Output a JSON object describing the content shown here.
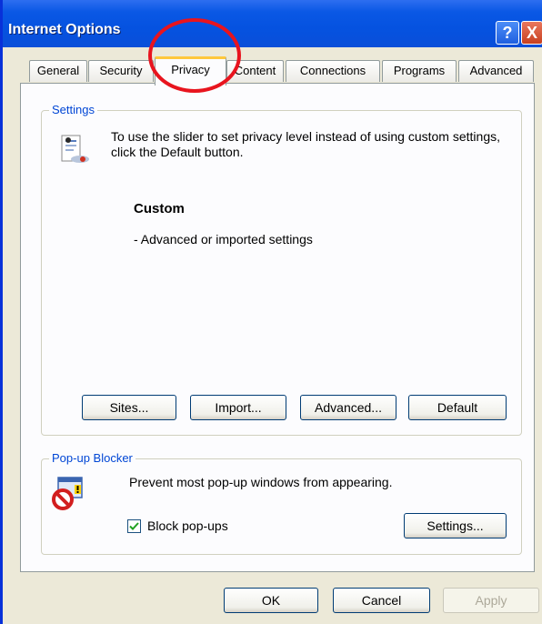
{
  "window": {
    "title": "Internet Options",
    "help_label": "?",
    "close_label": "X"
  },
  "tabs": [
    {
      "label": "General"
    },
    {
      "label": "Security"
    },
    {
      "label": "Privacy"
    },
    {
      "label": "Content"
    },
    {
      "label": "Connections"
    },
    {
      "label": "Programs"
    },
    {
      "label": "Advanced"
    }
  ],
  "active_tab": "Privacy",
  "settings": {
    "group_label": "Settings",
    "description": "To use the slider to set privacy level instead of using custom settings, click the Default button.",
    "level": "Custom",
    "detail": "- Advanced or imported settings",
    "buttons": {
      "sites": "Sites...",
      "import": "Import...",
      "advanced": "Advanced...",
      "default": "Default"
    }
  },
  "popup_blocker": {
    "group_label": "Pop-up Blocker",
    "description": "Prevent most pop-up windows from appearing.",
    "checkbox_label": "Block pop-ups",
    "checked": true,
    "settings_button": "Settings..."
  },
  "footer": {
    "ok": "OK",
    "cancel": "Cancel",
    "apply": "Apply"
  },
  "colors": {
    "titlebar": "#0552e0",
    "group_label": "#0046d5",
    "active_tab_accent": "#ffc83c",
    "annotation": "#e8141e",
    "checkmark": "#21a121"
  },
  "icons": [
    "help-icon",
    "close-icon",
    "privacy-shield-icon",
    "popup-blocked-icon",
    "checkmark-icon"
  ]
}
